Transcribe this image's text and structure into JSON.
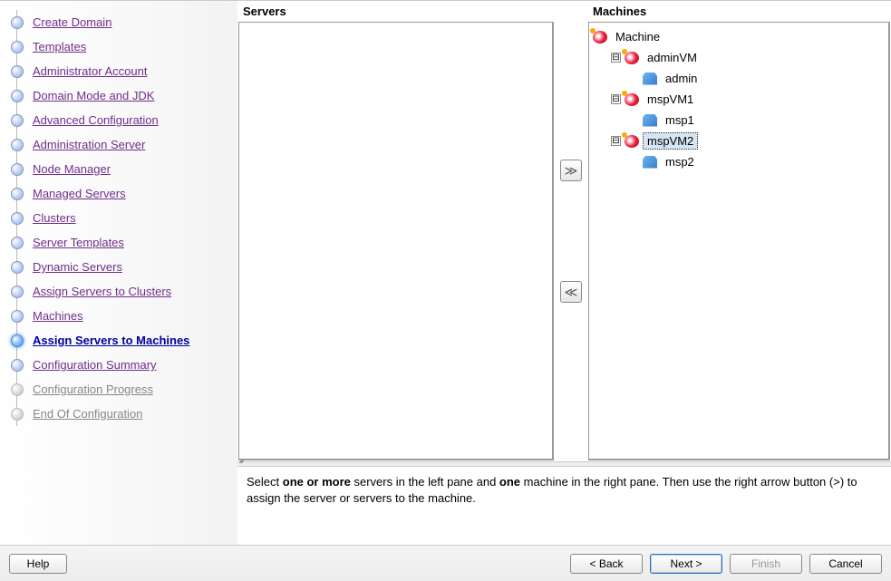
{
  "sidebar": {
    "steps": [
      {
        "label": "Create Domain",
        "state": "link"
      },
      {
        "label": "Templates",
        "state": "link"
      },
      {
        "label": "Administrator Account",
        "state": "link"
      },
      {
        "label": "Domain Mode and JDK",
        "state": "link"
      },
      {
        "label": "Advanced Configuration",
        "state": "link"
      },
      {
        "label": "Administration Server",
        "state": "link"
      },
      {
        "label": "Node Manager",
        "state": "link"
      },
      {
        "label": "Managed Servers",
        "state": "link"
      },
      {
        "label": "Clusters",
        "state": "link"
      },
      {
        "label": "Server Templates",
        "state": "link"
      },
      {
        "label": "Dynamic Servers",
        "state": "link"
      },
      {
        "label": "Assign Servers to Clusters",
        "state": "link"
      },
      {
        "label": "Machines",
        "state": "link"
      },
      {
        "label": "Assign Servers to Machines",
        "state": "current"
      },
      {
        "label": "Configuration Summary",
        "state": "link"
      },
      {
        "label": "Configuration Progress",
        "state": "disabled"
      },
      {
        "label": "End Of Configuration",
        "state": "disabled"
      }
    ]
  },
  "panes": {
    "left_title": "Servers",
    "right_title": "Machines"
  },
  "tree": {
    "root_label": "Machine",
    "nodes": [
      {
        "label": "adminVM",
        "children": [
          {
            "label": "admin"
          }
        ]
      },
      {
        "label": "mspVM1",
        "children": [
          {
            "label": "msp1"
          }
        ]
      },
      {
        "label": "mspVM2",
        "selected": true,
        "children": [
          {
            "label": "msp2"
          }
        ]
      }
    ],
    "collapse_glyph": "⊟"
  },
  "instructions": {
    "t1": "Select ",
    "b1": "one or more",
    "t2": " servers in the left pane and ",
    "b2": "one",
    "t3": " machine in the right pane. Then use the right arrow button (>) to assign the server or servers to the machine."
  },
  "footer": {
    "help": "Help",
    "back": "< Back",
    "next": "Next >",
    "finish": "Finish",
    "cancel": "Cancel"
  },
  "arrows": {
    "right": "≫",
    "left": "≪"
  }
}
